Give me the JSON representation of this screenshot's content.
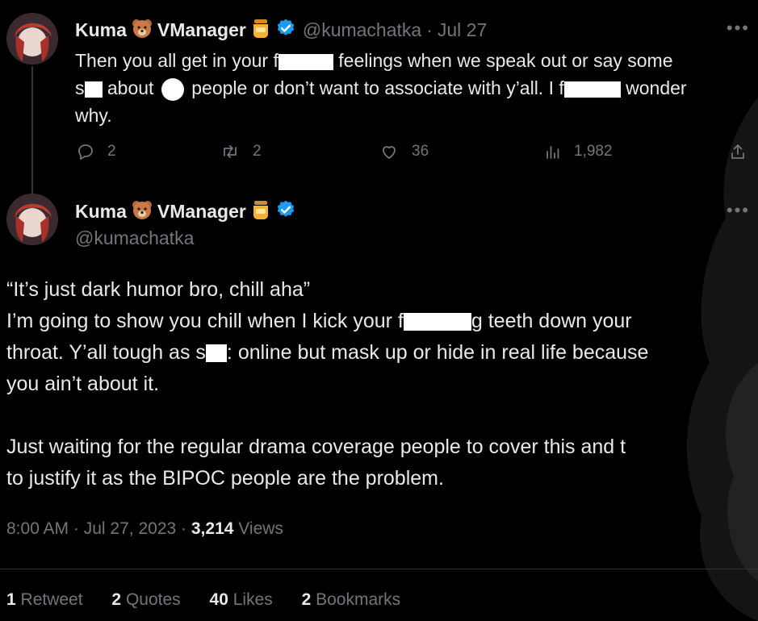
{
  "tweet1": {
    "display_name_1": "Kuma",
    "display_name_2": "VManager",
    "handle": "@kumachatka",
    "separator": "·",
    "date": "Jul 27",
    "text_lines": {
      "l1a": "Then you all get in your f",
      "l1b": "feelings when we speak out or say some",
      "l2a": "s",
      "l2b": "about",
      "l2c": "people or don’t want to associate with y’all. I f",
      "l2d": "wonder",
      "l3": "why."
    },
    "replies": "2",
    "retweets": "2",
    "likes": "36",
    "views": "1,982"
  },
  "tweet2": {
    "display_name_1": "Kuma",
    "display_name_2": "VManager",
    "handle": "@kumachatka",
    "text_lines": {
      "l1": "“It’s just dark humor bro, chill aha”",
      "l2a": "I’m going to show you chill when I kick your f",
      "l2b": "g teeth down your",
      "l3a": "throat. Y’all tough as s",
      "l3b": ": online but mask up or hide in real life because",
      "l4": "you ain’t about it.",
      "l5": "Just waiting for the regular drama coverage people to cover this and t",
      "l6": "to justify it as the BIPOC people are the problem."
    },
    "time": "8:00 AM",
    "date": "Jul 27, 2023",
    "separator": "·",
    "view_count": "3,214",
    "views_label": "Views",
    "retweet_count": "1",
    "retweet_label": "Retweet",
    "quote_count": "2",
    "quote_label": "Quotes",
    "like_count": "40",
    "like_label": "Likes",
    "bookmark_count": "2",
    "bookmark_label": "Bookmarks"
  },
  "colors": {
    "background": "#000000",
    "text": "#e7e9ea",
    "muted": "#71767b",
    "verified_blue": "#1d9bf0"
  },
  "icons": [
    "bear-emoji-icon",
    "honey-jar-emoji-icon",
    "verified-badge-icon",
    "more-icon",
    "reply-icon",
    "retweet-icon",
    "like-icon",
    "views-icon",
    "share-icon"
  ]
}
